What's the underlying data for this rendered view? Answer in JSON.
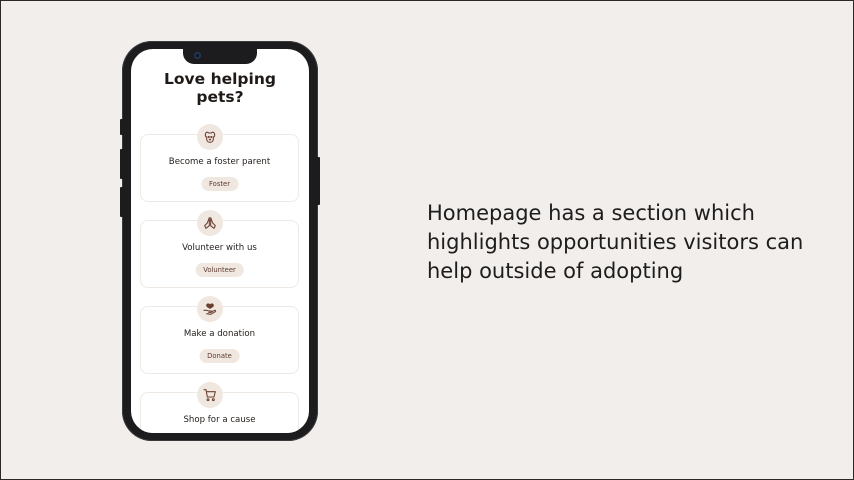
{
  "screen": {
    "title_line1": "Love helping",
    "title_line2": "pets?"
  },
  "cards": [
    {
      "icon": "dog-face-icon",
      "label": "Become a foster parent",
      "button": "Foster"
    },
    {
      "icon": "praying-hands-icon",
      "label": "Volunteer with us",
      "button": "Volunteer"
    },
    {
      "icon": "hand-heart-icon",
      "label": "Make a donation",
      "button": "Donate"
    },
    {
      "icon": "shopping-cart-icon",
      "label": "Shop for a cause",
      "button": ""
    }
  ],
  "caption": {
    "line1": "Homepage has a section which",
    "line2": "highlights opportunities visitors can",
    "line3": "help outside of adopting"
  },
  "colors": {
    "background": "#f2eeeb",
    "accent_soft": "#f1e7e1",
    "accent_text": "#5a3a2e",
    "phone_frame": "#1c1c1e"
  }
}
